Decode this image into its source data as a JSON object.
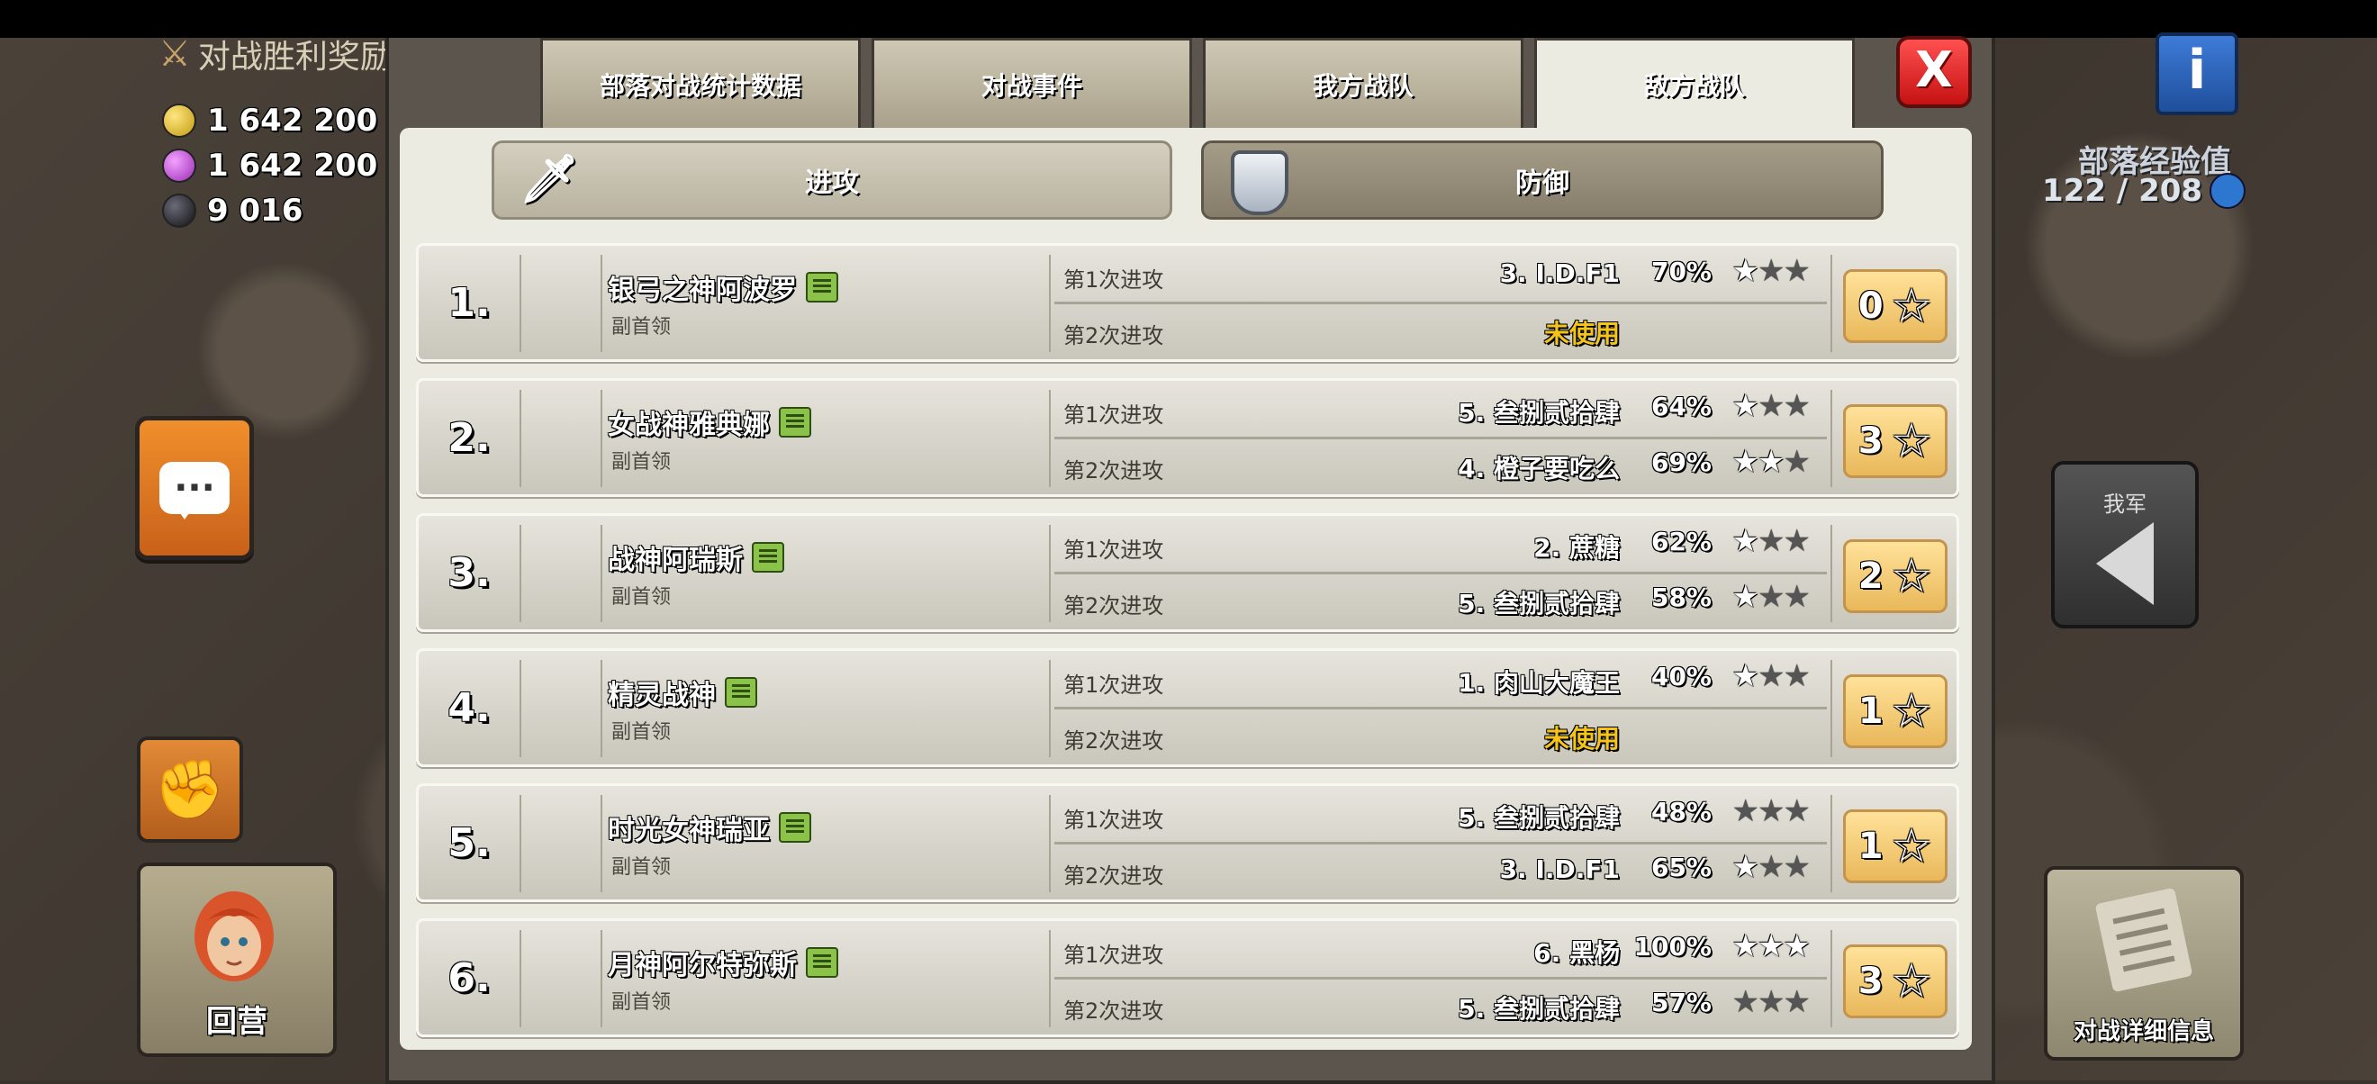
{
  "left": {
    "war_reward_label": "对战胜利奖励",
    "resources": [
      {
        "name": "gold",
        "value": "1 642 200"
      },
      {
        "name": "elixir",
        "value": "1 642 200"
      },
      {
        "name": "dark_elixir",
        "value": "9 016"
      }
    ],
    "home_label": "回营"
  },
  "right": {
    "clan_xp_title": "部落经验值",
    "clan_xp_value": "122 / 208",
    "ours_label": "我军",
    "details_label": "对战详细信息"
  },
  "tabs": [
    {
      "label": "部落对战统计数据",
      "active": false
    },
    {
      "label": "对战事件",
      "active": false
    },
    {
      "label": "我方战队",
      "active": false
    },
    {
      "label": "敌方战队",
      "active": true
    }
  ],
  "close_label": "X",
  "toggle": {
    "attack_label": "进攻",
    "defense_label": "防御"
  },
  "rows": [
    {
      "rank": "1.",
      "name": "银弓之神阿波罗",
      "role": "副首领",
      "attacks": [
        {
          "label": "第1次进攻",
          "target": "3. I.D.F1",
          "pct": "70%",
          "stars": 1,
          "used": true
        },
        {
          "label": "第2次进攻",
          "target": "未使用",
          "used": false
        }
      ],
      "total": "0"
    },
    {
      "rank": "2.",
      "name": "女战神雅典娜",
      "role": "副首领",
      "attacks": [
        {
          "label": "第1次进攻",
          "target": "5. 叁捌贰拾肆",
          "pct": "64%",
          "stars": 1,
          "used": true
        },
        {
          "label": "第2次进攻",
          "target": "4. 橙子要吃么",
          "pct": "69%",
          "stars": 2,
          "used": true
        }
      ],
      "total": "3"
    },
    {
      "rank": "3.",
      "name": "战神阿瑞斯",
      "role": "副首领",
      "attacks": [
        {
          "label": "第1次进攻",
          "target": "2. 蔗糖",
          "pct": "62%",
          "stars": 1,
          "used": true
        },
        {
          "label": "第2次进攻",
          "target": "5. 叁捌贰拾肆",
          "pct": "58%",
          "stars": 1,
          "used": true
        }
      ],
      "total": "2"
    },
    {
      "rank": "4.",
      "name": "精灵战神",
      "role": "副首领",
      "attacks": [
        {
          "label": "第1次进攻",
          "target": "1. 肉山大魔王",
          "pct": "40%",
          "stars": 1,
          "used": true
        },
        {
          "label": "第2次进攻",
          "target": "未使用",
          "used": false
        }
      ],
      "total": "1"
    },
    {
      "rank": "5.",
      "name": "时光女神瑞亚",
      "role": "副首领",
      "attacks": [
        {
          "label": "第1次进攻",
          "target": "5. 叁捌贰拾肆",
          "pct": "48%",
          "stars": 0,
          "used": true
        },
        {
          "label": "第2次进攻",
          "target": "3. I.D.F1",
          "pct": "65%",
          "stars": 1,
          "used": true
        }
      ],
      "total": "1"
    },
    {
      "rank": "6.",
      "name": "月神阿尔特弥斯",
      "role": "副首领",
      "attacks": [
        {
          "label": "第1次进攻",
          "target": "6. 黑杨",
          "pct": "100%",
          "stars": 3,
          "used": true
        },
        {
          "label": "第2次进攻",
          "target": "5. 叁捌贰拾肆",
          "pct": "57%",
          "stars": 0,
          "used": true
        }
      ],
      "total": "3"
    }
  ]
}
